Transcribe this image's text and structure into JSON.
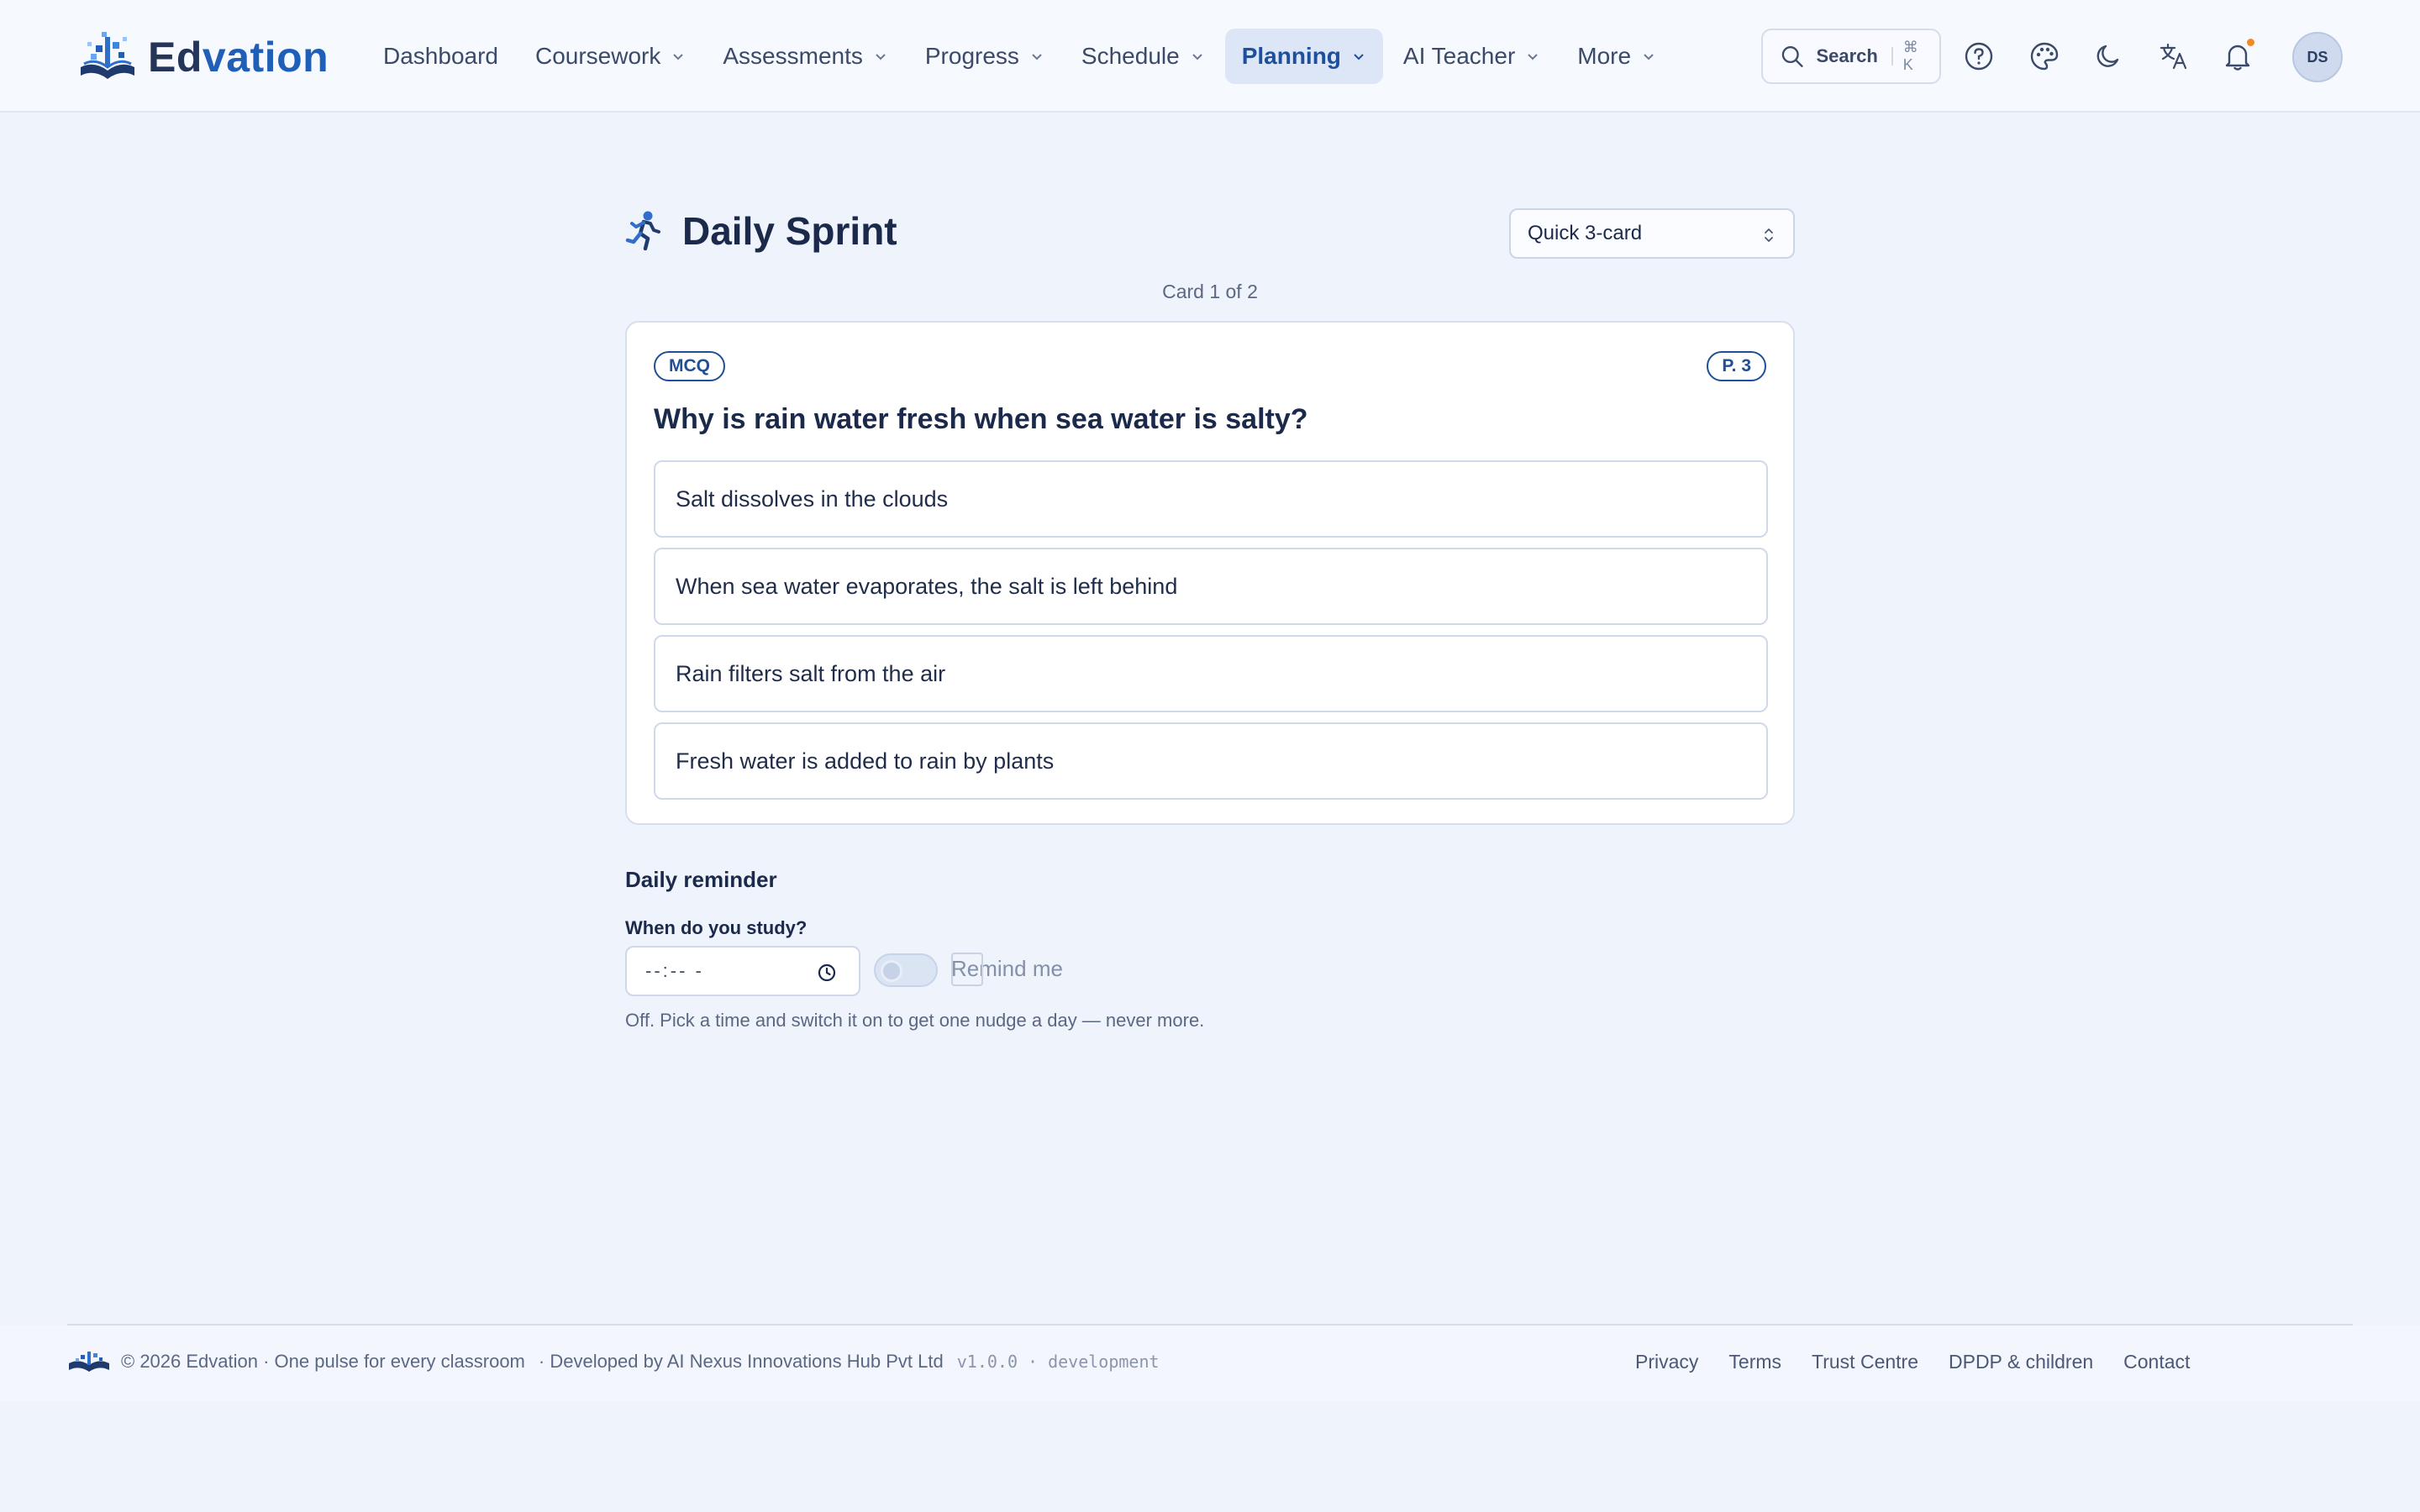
{
  "brand": {
    "name_part1": "Ed",
    "name_part2": "vation",
    "accent": "#1f5fb8"
  },
  "nav": {
    "items": [
      {
        "label": "Dashboard",
        "has_menu": false
      },
      {
        "label": "Coursework",
        "has_menu": true
      },
      {
        "label": "Assessments",
        "has_menu": true
      },
      {
        "label": "Progress",
        "has_menu": true
      },
      {
        "label": "Schedule",
        "has_menu": true
      },
      {
        "label": "Planning",
        "has_menu": true,
        "active": true
      },
      {
        "label": "AI Teacher",
        "has_menu": true
      },
      {
        "label": "More",
        "has_menu": true
      }
    ]
  },
  "header": {
    "search_label": "Search",
    "search_shortcut": "⌘ K",
    "icons": [
      "help-icon",
      "palette-icon",
      "moon-icon",
      "translate-icon",
      "bell-icon"
    ],
    "avatar_initials": "DS"
  },
  "page": {
    "title": "Daily Sprint",
    "mode_select_value": "Quick 3-card",
    "card_counter": "Card 1 of 2"
  },
  "card": {
    "type_badge": "MCQ",
    "grade_badge": "P. 3",
    "question": "Why is rain water fresh when sea water is salty?",
    "options": [
      "Salt dissolves in the clouds",
      "When sea water evaporates, the salt is left behind",
      "Rain filters salt from the air",
      "Fresh water is added to rain by plants"
    ]
  },
  "reminder": {
    "title": "Daily reminder",
    "time_label": "When do you study?",
    "time_value": "--:-- -",
    "toggle_label": "Remind me",
    "toggle_on": false,
    "hint": "Off. Pick a time and switch it on to get one nudge a day — never more."
  },
  "footer": {
    "copyright": "© 2026 Edvation · One pulse for every classroom",
    "developer": "· Developed by AI Nexus Innovations Hub Pvt Ltd",
    "version": "v1.0.0 · development",
    "links": [
      "Privacy",
      "Terms",
      "Trust Centre",
      "DPDP & children",
      "Contact"
    ]
  }
}
